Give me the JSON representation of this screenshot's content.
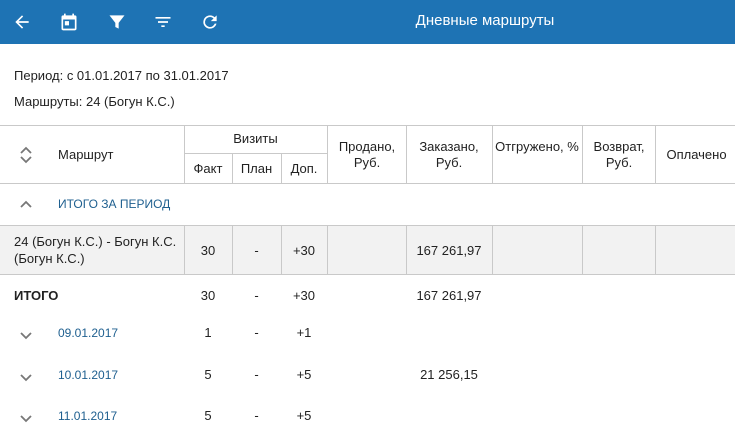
{
  "toolbar": {
    "icons": [
      "back-arrow-icon",
      "calendar-icon",
      "funnel-filter-icon",
      "sort-lines-icon",
      "refresh-icon"
    ],
    "title": "Дневные маршруты"
  },
  "info": {
    "period": "Период: с 01.01.2017 по 31.01.2017",
    "routes": "Маршруты: 24 (Богун К.С.)"
  },
  "table": {
    "headers": {
      "route": "Маршрут",
      "visits": "Визиты",
      "fact": "Факт",
      "plan": "План",
      "extra": "Доп.",
      "sold": "Продано, Руб.",
      "ordered": "Заказано, Руб.",
      "shipped": "Отгружено, %",
      "returned": "Возврат, Руб.",
      "paid": "Оплачено"
    },
    "period_total_label": "ИТОГО ЗА ПЕРИОД",
    "route_row": {
      "name": "24 (Богун К.С.) - Богун К.С. (Богун К.С.)",
      "fact": "30",
      "plan": "-",
      "extra": "+30",
      "ordered": "167 261,97"
    },
    "total_row": {
      "label": "ИТОГО",
      "fact": "30",
      "plan": "-",
      "extra": "+30",
      "ordered": "167 261,97"
    },
    "day_rows": [
      {
        "date": "09.01.2017",
        "fact": "1",
        "plan": "-",
        "extra": "+1",
        "ordered": ""
      },
      {
        "date": "10.01.2017",
        "fact": "5",
        "plan": "-",
        "extra": "+5",
        "ordered": "21 256,15"
      },
      {
        "date": "11.01.2017",
        "fact": "5",
        "plan": "-",
        "extra": "+5",
        "ordered": ""
      }
    ]
  },
  "colors": {
    "appbar": "#1e73b4",
    "link_blue": "#1e5f8f",
    "row_highlight": "#f2f2f2"
  }
}
